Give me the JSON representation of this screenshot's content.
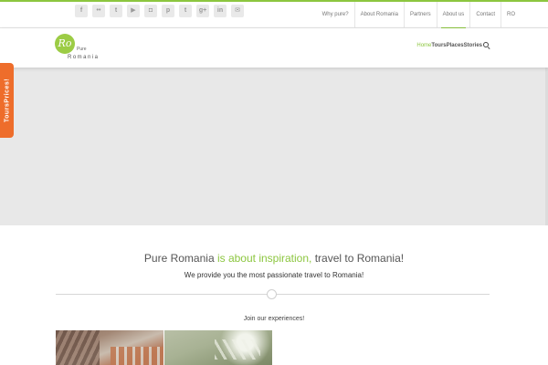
{
  "socials": [
    {
      "icon": "facebook-icon",
      "glyph": "f"
    },
    {
      "icon": "flickr-icon",
      "glyph": "••"
    },
    {
      "icon": "twitter-icon",
      "glyph": "t"
    },
    {
      "icon": "youtube-icon",
      "glyph": "▶"
    },
    {
      "icon": "instagram-icon",
      "glyph": "◘"
    },
    {
      "icon": "pinterest-icon",
      "glyph": "p"
    },
    {
      "icon": "tumblr-icon",
      "glyph": "t"
    },
    {
      "icon": "google-plus-icon",
      "glyph": "g+"
    },
    {
      "icon": "linkedin-icon",
      "glyph": "in"
    },
    {
      "icon": "mail-icon",
      "glyph": "✉"
    }
  ],
  "topnav": {
    "why_pure": "Why pure?",
    "about_romania": "About Romania",
    "partners": "Partners",
    "about_us": "About us",
    "contact": "Contact",
    "lang": "RO"
  },
  "logo": {
    "mark": "Ro",
    "pure": "Pure",
    "name": "Romania"
  },
  "mainnav": {
    "home": "Home",
    "tours": "Tours",
    "places": "Places",
    "stories": "Stories"
  },
  "side_tab": "ToursPrices!",
  "intro": {
    "headline_part1": "Pure Romania ",
    "headline_highlight": "is about inspiration,",
    "headline_part2": " travel to Romania!",
    "subline": "We provide you the most passionate travel to Romania!",
    "join": "Join our experiences!"
  },
  "colors": {
    "accent": "#8cc63f",
    "side_tab": "#ee6d2b"
  }
}
